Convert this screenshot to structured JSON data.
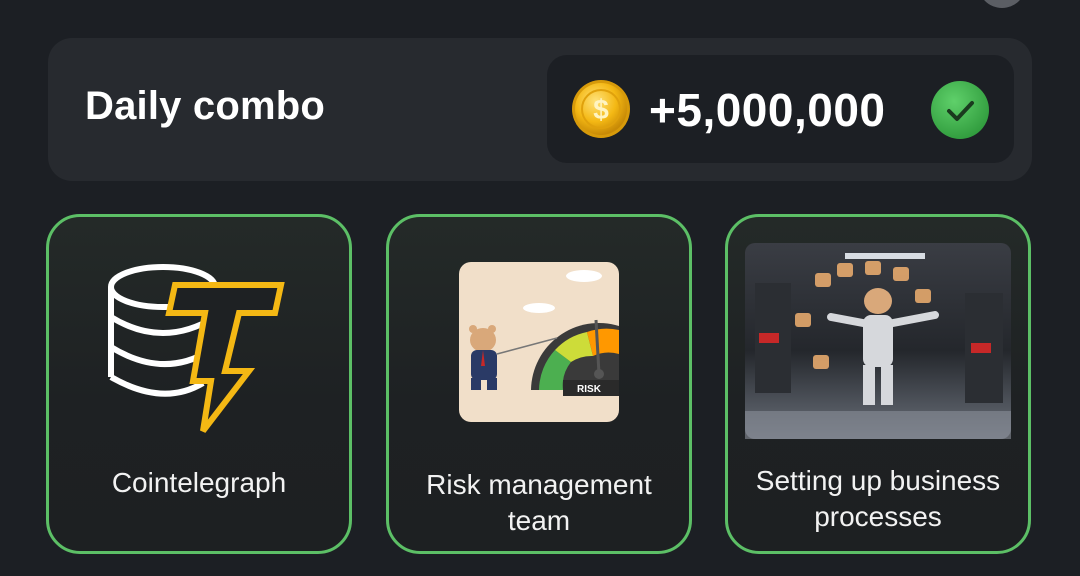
{
  "daily_combo": {
    "title": "Daily combo",
    "reward": "+5,000,000",
    "coin_icon": "gold-coin-icon",
    "status_icon": "check-icon",
    "status_color": "#4caf50"
  },
  "cards": [
    {
      "label": "Cointelegraph",
      "image": "cointelegraph-logo",
      "found": true
    },
    {
      "label": "Risk management team",
      "image": "risk-gauge-image",
      "found": true,
      "image_text": "RISK"
    },
    {
      "label": "Setting up business processes",
      "image": "factory-hamster-image",
      "found": true
    }
  ],
  "colors": {
    "background": "#1c1f24",
    "panel": "#272a2f",
    "accent_border": "#5cbf66",
    "coin": "#f4b814"
  }
}
